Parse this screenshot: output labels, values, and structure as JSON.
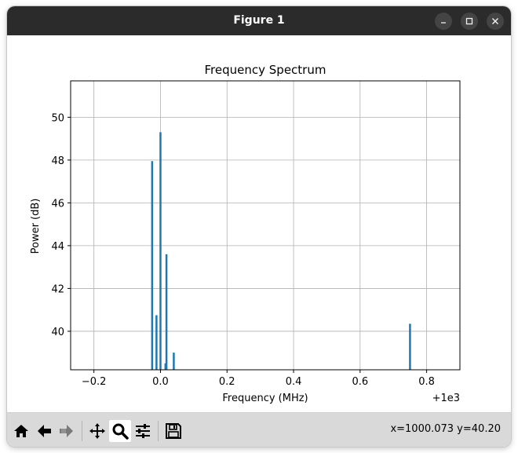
{
  "window": {
    "title": "Figure 1",
    "controls": [
      "minimize",
      "maximize",
      "close"
    ]
  },
  "toolbar": {
    "buttons": [
      {
        "name": "home",
        "icon": "home-icon"
      },
      {
        "name": "back",
        "icon": "back-arrow-icon"
      },
      {
        "name": "forward",
        "icon": "forward-arrow-icon"
      },
      {
        "name": "pan",
        "icon": "move-icon"
      },
      {
        "name": "zoom",
        "icon": "magnifier-icon",
        "active": true
      },
      {
        "name": "configure-subplots",
        "icon": "sliders-icon"
      },
      {
        "name": "save",
        "icon": "save-icon"
      }
    ],
    "coordinates": "x=1000.073 y=40.20"
  },
  "chart_data": {
    "type": "bar",
    "title": "Frequency Spectrum",
    "xlabel": "Frequency (MHz)",
    "ylabel": "Power (dB)",
    "x_offset_label": "+1e3",
    "x_tick_labels": [
      "−0.2",
      "0.0",
      "0.2",
      "0.4",
      "0.6",
      "0.8"
    ],
    "y_tick_labels": [
      "40",
      "42",
      "44",
      "46",
      "48",
      "50"
    ],
    "xlim": [
      -0.27,
      0.9
    ],
    "ylim": [
      38.2,
      51.7
    ],
    "grid": true,
    "bar_color": "#1f77b4",
    "bar_base": 38.2,
    "series": [
      {
        "x": [
          -0.025,
          -0.012,
          0.0,
          0.015,
          0.018,
          0.04,
          0.75
        ],
        "values": [
          47.95,
          40.75,
          49.3,
          38.5,
          43.6,
          39.0,
          40.35
        ]
      }
    ]
  }
}
